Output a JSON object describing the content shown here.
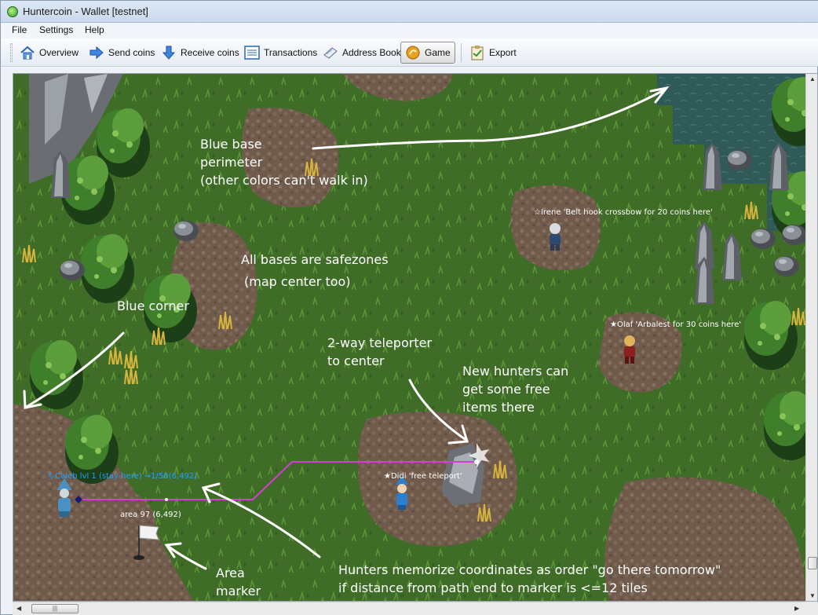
{
  "window": {
    "title": "Huntercoin - Wallet [testnet]"
  },
  "menu": {
    "file": "File",
    "settings": "Settings",
    "help": "Help"
  },
  "toolbar": {
    "overview": "Overview",
    "send": "Send coins",
    "receive": "Receive coins",
    "transactions": "Transactions",
    "addressbook": "Address Book",
    "game": "Game",
    "export": "Export"
  },
  "annotations": {
    "blue_base": "Blue base\nperimeter\n(other colors can't walk in)",
    "safezones": "All bases are safezones",
    "map_center": "(map center too)",
    "blue_corner": "Blue corner",
    "teleporter": "2-way teleporter\nto center",
    "free_items": "New hunters can\nget some free\nitems there",
    "area_marker": "Area\nmarker",
    "memorize": "Hunters memorize coordinates as order \"go there tomorrow\"\nif distance from path end to marker is <=12 tiles"
  },
  "players": {
    "irene": "☆Irene 'Belt hook crossbow for 20 coins here'",
    "olaf": "★Olaf 'Arbalest for 30 coins here'",
    "didi": "★Didi 'free teleport'",
    "caleb": "§ Caleb  lvl 1 (stay here) ⇒1/50(6,492)",
    "area": "area 97 (6,492)"
  },
  "colors": {
    "path": "#d23fd2",
    "team_blue": "#1ea0ff",
    "grass": "#3c6a27"
  }
}
